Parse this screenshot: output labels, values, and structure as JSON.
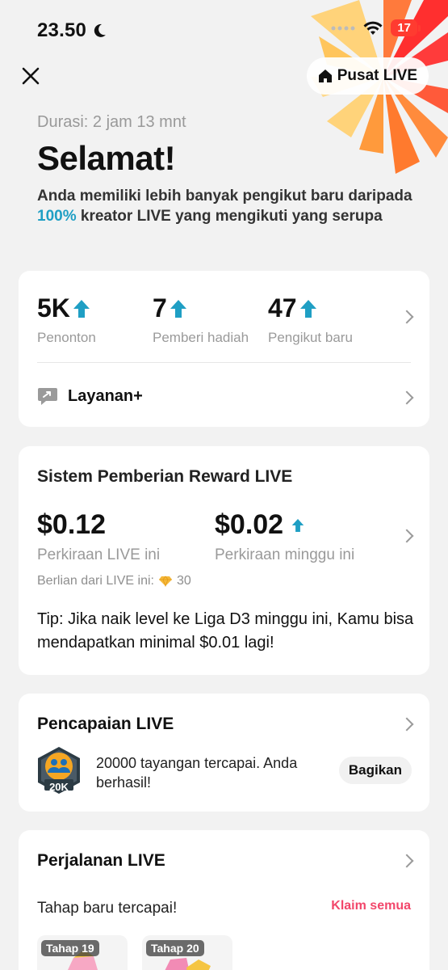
{
  "status_bar": {
    "time": "23.50",
    "battery": "17"
  },
  "header": {
    "pusat_live_label": "Pusat LIVE"
  },
  "summary": {
    "duration": "Durasi: 2 jam 13 mnt",
    "title": "Selamat!",
    "subtitle_before": "Anda memiliki lebih banyak pengikut baru daripada ",
    "subtitle_percent": "100%",
    "subtitle_after": " kreator LIVE yang mengikuti yang serupa"
  },
  "stats": [
    {
      "value": "5K",
      "label": "Penonton"
    },
    {
      "value": "7",
      "label": "Pemberi hadiah"
    },
    {
      "value": "47",
      "label": "Pengikut baru"
    }
  ],
  "layanan": {
    "label": "Layanan+"
  },
  "reward": {
    "title": "Sistem Pemberian Reward LIVE",
    "live_value": "$0.12",
    "live_label": "Perkiraan LIVE ini",
    "week_value": "$0.02",
    "week_label": "Perkiraan minggu ini",
    "diamonds_label": "Berlian dari LIVE ini:",
    "diamonds_count": "30",
    "tip": "Tip: Jika naik level ke Liga D3 minggu ini, Kamu bisa mendapatkan minimal $0.01 lagi!"
  },
  "achievement": {
    "title": "Pencapaian LIVE",
    "badge_label": "20K",
    "text": "20000 tayangan tercapai. Anda berhasil!",
    "share_label": "Bagikan"
  },
  "journey": {
    "title": "Perjalanan LIVE",
    "stage_text": "Tahap baru tercapai!",
    "claim_all": "Klaim semua",
    "stages": [
      "Tahap 19",
      "Tahap 20"
    ]
  },
  "colors": {
    "accent": "#1f9fc4",
    "claim": "#f2476b",
    "battery": "#ff3b30"
  }
}
